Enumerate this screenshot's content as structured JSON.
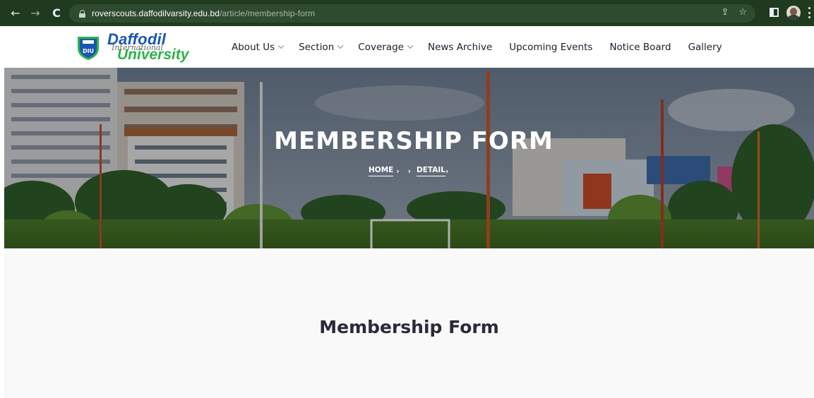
{
  "browser": {
    "url_host": "roverscouts.daffodilvarsity.edu.bd",
    "url_path": "/article/membership-form"
  },
  "site": {
    "logo": {
      "line1": "Daffodil",
      "line2": "International",
      "line3": "University",
      "badge": "DIU"
    },
    "nav": [
      {
        "label": "About Us",
        "dropdown": true
      },
      {
        "label": "Section",
        "dropdown": true
      },
      {
        "label": "Coverage",
        "dropdown": true
      },
      {
        "label": "News Archive",
        "dropdown": false
      },
      {
        "label": "Upcoming Events",
        "dropdown": false
      },
      {
        "label": "Notice Board",
        "dropdown": false
      },
      {
        "label": "Gallery",
        "dropdown": false
      }
    ]
  },
  "hero": {
    "title": "MEMBERSHIP FORM",
    "breadcrumb": {
      "home": "HOME",
      "sep1": "›",
      "sep2": "›",
      "detail": "DETAIL"
    }
  },
  "main": {
    "heading": "Membership Form"
  },
  "colors": {
    "browser_bar": "#1f3a1f",
    "logo_blue": "#1a56b0",
    "logo_green": "#2db34a",
    "heading": "#2a2a3a"
  }
}
